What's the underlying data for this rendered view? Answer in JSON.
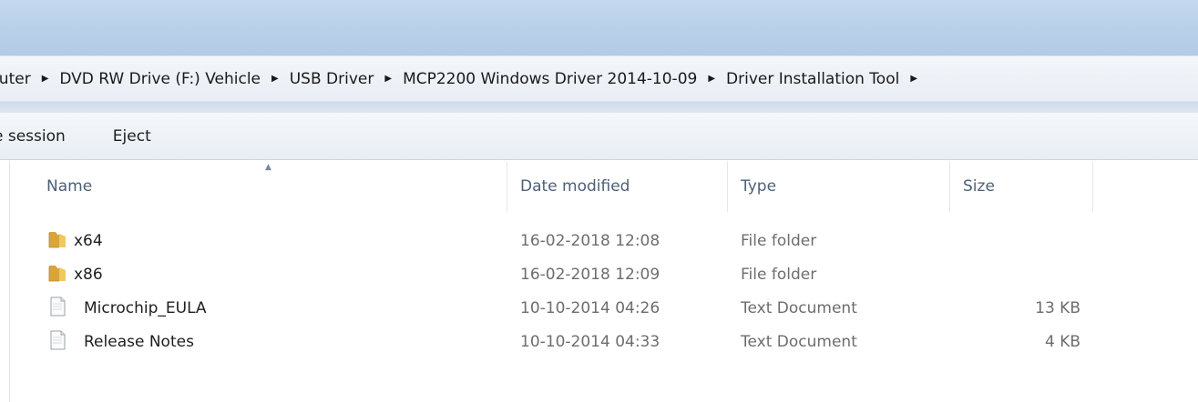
{
  "breadcrumb": {
    "items": [
      "puter",
      "DVD RW Drive (F:) Vehicle",
      "USB Driver",
      "MCP2200 Windows Driver 2014-10-09",
      "Driver Installation Tool"
    ]
  },
  "toolbar": {
    "session_label": "e session",
    "eject_label": "Eject"
  },
  "columns": {
    "name": "Name",
    "date": "Date modified",
    "type": "Type",
    "size": "Size"
  },
  "files": [
    {
      "name": "x64",
      "date": "16-02-2018 12:08",
      "type": "File folder",
      "size": "",
      "icon": "folder-icon"
    },
    {
      "name": "x86",
      "date": "16-02-2018 12:09",
      "type": "File folder",
      "size": "",
      "icon": "folder-icon"
    },
    {
      "name": "Microchip_EULA",
      "date": "10-10-2014 04:26",
      "type": "Text Document",
      "size": "13 KB",
      "icon": "text-document-icon"
    },
    {
      "name": "Release Notes",
      "date": "10-10-2014 04:33",
      "type": "Text Document",
      "size": "4 KB",
      "icon": "text-document-icon"
    }
  ],
  "colors": {
    "title_bar": "#b9d0ea",
    "header_text": "#4d6078",
    "folder": "#e8b84a"
  }
}
